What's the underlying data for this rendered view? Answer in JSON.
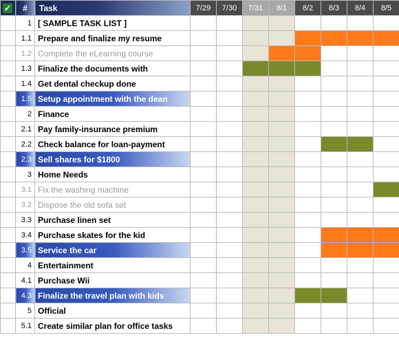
{
  "header": {
    "num": "#",
    "task": "Task",
    "dates": [
      "7/29",
      "7/30",
      "7/31",
      "8/1",
      "8/2",
      "8/3",
      "8/4",
      "8/5"
    ],
    "weekend_cols": [
      2,
      3
    ]
  },
  "rows": [
    {
      "num": "1",
      "task": "[ SAMPLE TASK LIST ]",
      "style": "",
      "bars": []
    },
    {
      "num": "1.1",
      "task": "Prepare and finalize my resume",
      "style": "",
      "bars": [
        {
          "col": 4,
          "span": 4,
          "color": "orange"
        }
      ]
    },
    {
      "num": "1.2",
      "task": "Complete the eLearning course",
      "style": "muted",
      "bars": [
        {
          "col": 3,
          "span": 2,
          "color": "orange"
        }
      ]
    },
    {
      "num": "1.3",
      "task": "Finalize the documents with",
      "style": "",
      "bars": [
        {
          "col": 2,
          "span": 3,
          "color": "green"
        }
      ]
    },
    {
      "num": "1.4",
      "task": "Get dental checkup done",
      "style": "",
      "bars": []
    },
    {
      "num": "1.5",
      "task": "Setup appointment with the dean",
      "style": "sel",
      "bars": []
    },
    {
      "num": "2",
      "task": "Finance",
      "style": "",
      "bars": []
    },
    {
      "num": "2.1",
      "task": "Pay family-insurance premium",
      "style": "",
      "bars": []
    },
    {
      "num": "2.2",
      "task": "Check balance for loan-payment",
      "style": "",
      "bars": [
        {
          "col": 5,
          "span": 2,
          "color": "green"
        }
      ]
    },
    {
      "num": "2.3",
      "task": "Sell shares for $1800",
      "style": "sel",
      "bars": []
    },
    {
      "num": "3",
      "task": "Home Needs",
      "style": "",
      "bars": []
    },
    {
      "num": "3.1",
      "task": "Fix the washing machine",
      "style": "muted",
      "bars": [
        {
          "col": 7,
          "span": 1,
          "color": "green"
        }
      ]
    },
    {
      "num": "3.2",
      "task": "Dispose the old sofa set",
      "style": "muted",
      "bars": []
    },
    {
      "num": "3.3",
      "task": "Purchase linen set",
      "style": "",
      "bars": []
    },
    {
      "num": "3.4",
      "task": "Purchase skates for the kid",
      "style": "",
      "bars": [
        {
          "col": 5,
          "span": 3,
          "color": "orange"
        }
      ]
    },
    {
      "num": "3.5",
      "task": "Service the car",
      "style": "sel",
      "bars": [
        {
          "col": 5,
          "span": 3,
          "color": "orange"
        }
      ]
    },
    {
      "num": "4",
      "task": "Entertainment",
      "style": "",
      "bars": []
    },
    {
      "num": "4.1",
      "task": "Purchase Wii",
      "style": "",
      "bars": []
    },
    {
      "num": "4.3",
      "task": "Finalize the travel plan with kids",
      "style": "sel",
      "bars": [
        {
          "col": 4,
          "span": 2,
          "color": "green"
        }
      ]
    },
    {
      "num": "5",
      "task": "Official",
      "style": "",
      "bars": []
    },
    {
      "num": "5.1",
      "task": "Create similar plan for office tasks",
      "style": "",
      "bars": []
    }
  ]
}
